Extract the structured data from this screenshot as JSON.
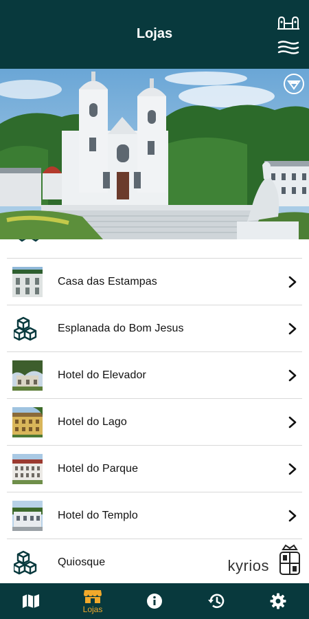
{
  "header": {
    "title": "Lojas",
    "top_icon": "bom-jesus-logo-icon",
    "menu_icon": "menu-waves-icon"
  },
  "hero": {
    "image": "bom-jesus-sanctuary-photo",
    "badge_icon": "unesco-heritage-icon"
  },
  "list": {
    "items": [
      {
        "label": "Casa das Estampas",
        "thumb": "photo"
      },
      {
        "label": "Esplanada do Bom Jesus",
        "thumb": "boxes-icon"
      },
      {
        "label": "Hotel do Elevador",
        "thumb": "photo"
      },
      {
        "label": "Hotel do Lago",
        "thumb": "photo"
      },
      {
        "label": "Hotel do Parque",
        "thumb": "photo"
      },
      {
        "label": "Hotel do Templo",
        "thumb": "photo"
      },
      {
        "label": "Quiosque",
        "thumb": "boxes-icon"
      }
    ]
  },
  "branding": {
    "company": "kyrios",
    "crest_icon": "confraria-crest-icon"
  },
  "nav": {
    "active_label": "Lojas",
    "items": [
      "map-icon",
      "store-icon",
      "info-icon",
      "history-icon",
      "settings-icon"
    ]
  },
  "colors": {
    "primary": "#08393d",
    "accent": "#f1a92b",
    "divider": "#d8d8d8"
  }
}
